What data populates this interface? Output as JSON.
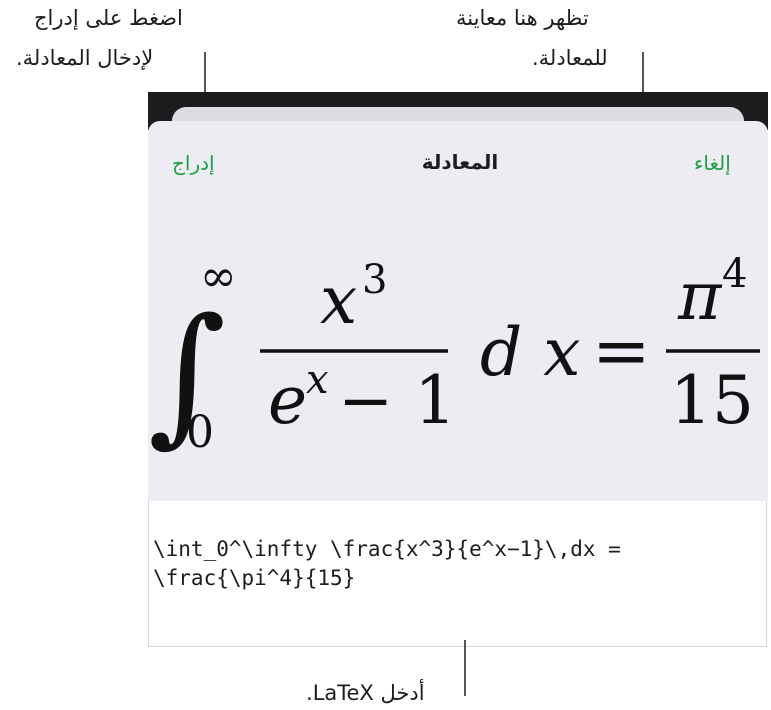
{
  "callouts": {
    "insert_line1": "اضغط على إدراج",
    "insert_line2": "لإدخال المعادلة.",
    "preview_line1": "تظهر هنا معاينة",
    "preview_line2": "للمعادلة.",
    "latex_hint": "أدخل LaTeX."
  },
  "dialog": {
    "title": "المعادلة",
    "insert_label": "إدراج",
    "cancel_label": "إلغاء"
  },
  "equation": {
    "int_lower": "0",
    "int_upper": "∞",
    "integrand_numerator_base": "x",
    "integrand_numerator_exp": "3",
    "integrand_denominator_base": "e",
    "integrand_denominator_exp": "x",
    "integrand_denominator_rest": "− 1",
    "differential": "d x",
    "equals": "=",
    "result_numerator_base": "π",
    "result_numerator_exp": "4",
    "result_denominator": "15"
  },
  "editor": {
    "latex_line1": "\\int_0^\\infty \\frac{x^3}{e^x−1}\\,dx =",
    "latex_line2": "\\frac{\\pi^4}{15}"
  },
  "colors": {
    "accent_green": "#1fa046",
    "sheet_background": "#ececf2",
    "device_top": "#1c1c1e"
  }
}
